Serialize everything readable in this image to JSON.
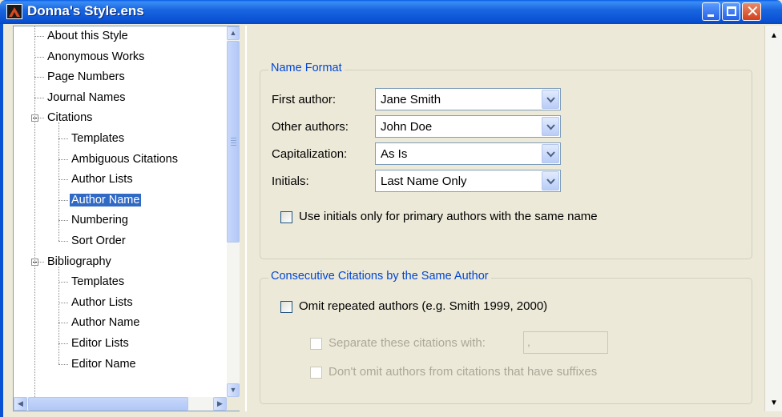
{
  "window": {
    "title": "Donna's Style.ens",
    "min_label": "minimize",
    "max_label": "maximize",
    "close_symbol": "✕"
  },
  "tree": {
    "items": [
      {
        "label": "About this Style",
        "level": 0
      },
      {
        "label": "Anonymous Works",
        "level": 0
      },
      {
        "label": "Page Numbers",
        "level": 0
      },
      {
        "label": "Journal Names",
        "level": 0
      },
      {
        "label": "Citations",
        "level": 0,
        "expanded": true
      },
      {
        "label": "Templates",
        "level": 1
      },
      {
        "label": "Ambiguous Citations",
        "level": 1
      },
      {
        "label": "Author Lists",
        "level": 1
      },
      {
        "label": "Author Name",
        "level": 1,
        "selected": true
      },
      {
        "label": "Numbering",
        "level": 1
      },
      {
        "label": "Sort Order",
        "level": 1
      },
      {
        "label": "Bibliography",
        "level": 0,
        "expanded": true
      },
      {
        "label": "Templates",
        "level": 1
      },
      {
        "label": "Author Lists",
        "level": 1
      },
      {
        "label": "Author Name",
        "level": 1
      },
      {
        "label": "Editor Lists",
        "level": 1
      },
      {
        "label": "Editor Name",
        "level": 1
      }
    ]
  },
  "name_format": {
    "legend": "Name Format",
    "first_author": {
      "label": "First author:",
      "value": "Jane Smith"
    },
    "other_authors": {
      "label": "Other authors:",
      "value": "John Doe"
    },
    "capitalization": {
      "label": "Capitalization:",
      "value": "As Is"
    },
    "initials": {
      "label": "Initials:",
      "value": "Last Name Only"
    },
    "use_initials": {
      "label": "Use initials only for primary authors with the same name",
      "checked": false
    }
  },
  "consecutive": {
    "legend": "Consecutive Citations by the Same Author",
    "omit_repeated": {
      "label": "Omit repeated authors (e.g. Smith 1999, 2000)",
      "checked": false
    },
    "separate": {
      "label": "Separate these citations with:",
      "checked": false,
      "enabled": false,
      "value": ","
    },
    "dont_omit": {
      "label": "Don't omit authors from citations that have suffixes",
      "checked": false,
      "enabled": false
    }
  },
  "colors": {
    "titlebar": "#0a52d4",
    "selection": "#316ac5",
    "legend_text": "#0046d5",
    "disabled_text": "#aca899"
  }
}
